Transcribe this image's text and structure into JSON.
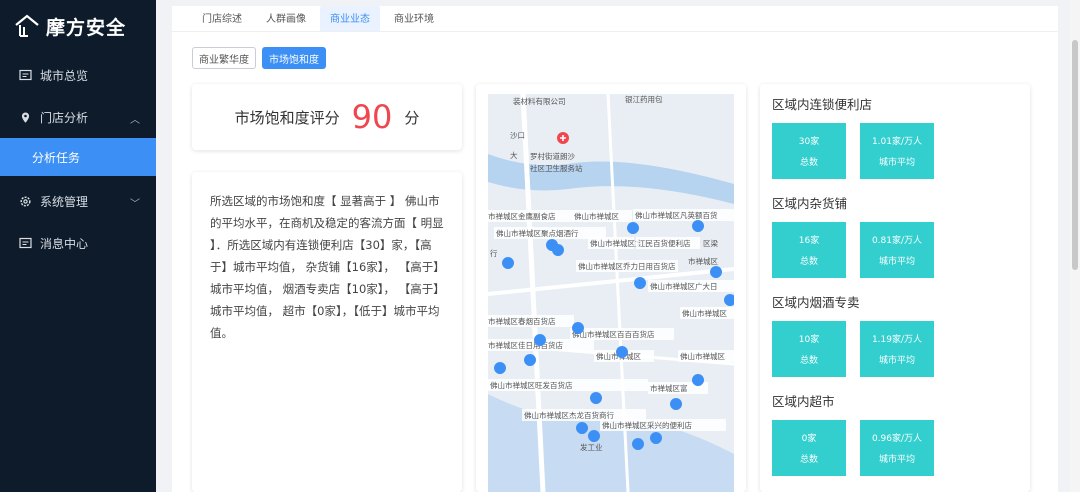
{
  "app": {
    "logo_text": "摩方安全"
  },
  "sidebar": {
    "items": [
      {
        "label": "城市总览",
        "icon": "chat-icon"
      },
      {
        "label": "门店分析",
        "icon": "location-pin-icon",
        "expanded": true
      },
      {
        "label": "系统管理",
        "icon": "gear-icon",
        "expanded": false
      },
      {
        "label": "消息中心",
        "icon": "message-icon"
      }
    ],
    "sub_item": {
      "label": "分析任务",
      "active": true
    }
  },
  "tabs": [
    {
      "label": "门店综述",
      "active": false
    },
    {
      "label": "人群画像",
      "active": false
    },
    {
      "label": "商业业态",
      "active": true
    },
    {
      "label": "商业环境",
      "active": false
    }
  ],
  "filters": {
    "btn1": "商业繁华度",
    "btn2": "市场饱和度"
  },
  "score": {
    "label": "市场饱和度评分",
    "value": "90",
    "unit": "分"
  },
  "description": "所选区域的市场饱和度【 显著高于 】 佛山市的平均水平，在商机及稳定的客流方面【 明显 】．所选区域内有连锁便利店【30】家，【高于】城市平均值， 杂货铺【16家】， 【高于】城市平均值， 烟酒专卖店【10家】， 【高于】城市平均值， 超市【0家】，【低于】城市平均值。",
  "map": {
    "labels": [
      "装材料有限公司",
      "银江药用包",
      "沙口",
      "大",
      "罗村街道朗沙",
      "社区卫生服务站",
      "市禅城区金鹰副食店",
      "佛山市禅城区",
      "佛山市禅城区凡英额百货",
      "佛山市禅城区聚点烟酒行",
      "佛山市禅城区文汇",
      "江民百货便利店",
      "区梁",
      "行",
      "佛山市禅城区乔力日用百货店",
      "市禅城区",
      "佛山市禅城区广大日",
      "佛山市禅城区",
      "市禅城区春烟百货店",
      "佛山市禅城区百百百货店",
      "市禅城区佳日用百货店",
      "佛山市禅城区",
      "佛山市禅城区",
      "佛山市禅城区旺发百货店",
      "市禅城区富",
      "佛山市禅城区杰龙百货商行",
      "佛山市禅城区采兴的便利店",
      "发工业"
    ]
  },
  "stats": [
    {
      "title": "区域内连锁便利店",
      "count": "30家",
      "count_label": "总数",
      "avg": "1.01家/万人",
      "avg_label": "城市平均"
    },
    {
      "title": "区域内杂货铺",
      "count": "16家",
      "count_label": "总数",
      "avg": "0.81家/万人",
      "avg_label": "城市平均"
    },
    {
      "title": "区域内烟酒专卖",
      "count": "10家",
      "count_label": "总数",
      "avg": "1.19家/万人",
      "avg_label": "城市平均"
    },
    {
      "title": "区域内超市",
      "count": "0家",
      "count_label": "总数",
      "avg": "0.96家/万人",
      "avg_label": "城市平均"
    }
  ],
  "colors": {
    "sidebar_bg": "#0d1b2a",
    "accent": "#3b8ff5",
    "score_red": "#f0474e",
    "stat_teal": "#33cfcf"
  }
}
